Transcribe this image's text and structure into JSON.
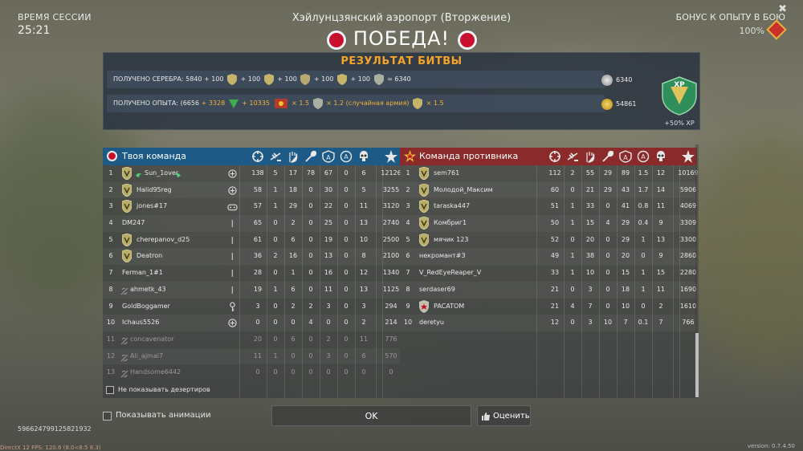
{
  "session": {
    "label": "ВРЕМЯ СЕССИИ",
    "time": "25:21"
  },
  "map_name": "Хэйлунцзянский аэропорт (Вторжение)",
  "result_title": "ПОБЕДА!",
  "xp_bonus": {
    "label": "БОНУС К ОПЫТУ В БОЮ",
    "value": "100%",
    "icon": "rank-badge-icon"
  },
  "battle_result": {
    "title": "РЕЗУЛЬТАТ БИТВЫ",
    "silver": {
      "label": "ПОЛУЧЕНО СЕРЕБРА:",
      "base": "5840",
      "plus1": "+ 100",
      "plus2": "+ 100",
      "plus3": "+ 100",
      "plus4": "+ 100",
      "plus5": "+ 100",
      "equals": "= 6340",
      "total": "6340",
      "icon": "silver-coin-icon"
    },
    "xp": {
      "label": "ПОЛУЧЕНО ОПЫТА: (6656",
      "plus1": "+ 3328",
      "plus2": "+ 10335",
      "mult1": "× 1.5",
      "mult2": "× 1.2 (случайная армия)",
      "mult3": "× 1.5",
      "total": "54861",
      "icon": "gold-coin-icon"
    },
    "xp_badge": "XP",
    "xp_percent": "+50% XP"
  },
  "my_team": {
    "title": "Твоя команда",
    "color": "#1e5a86",
    "columns": [
      "kills-target-icon",
      "planes-destroyed-icon",
      "assists-hand-icon",
      "repairs-wrench-icon",
      "captures-a-icon",
      "capture-defense-icon",
      "deaths-skull-icon",
      "score-star-icon"
    ],
    "players": [
      {
        "n": "1",
        "name": "Sun_1over",
        "rank": true,
        "squad": true,
        "status": "plus",
        "k": "138",
        "p": "5",
        "a": "17",
        "r": "78",
        "c": "67",
        "d": "0",
        "s": "6",
        "sc": "12126"
      },
      {
        "n": "2",
        "name": "Halid95reg",
        "rank": true,
        "status": "plus",
        "k": "58",
        "p": "1",
        "a": "18",
        "r": "0",
        "c": "30",
        "d": "0",
        "s": "5",
        "sc": "3255"
      },
      {
        "n": "3",
        "name": "jones#17",
        "rank": true,
        "status": "gamepad",
        "k": "57",
        "p": "1",
        "a": "29",
        "r": "0",
        "c": "22",
        "d": "0",
        "s": "11",
        "sc": "3120"
      },
      {
        "n": "4",
        "name": "DM247",
        "rank": false,
        "status": "bar",
        "k": "65",
        "p": "0",
        "a": "2",
        "r": "0",
        "c": "25",
        "d": "0",
        "s": "13",
        "sc": "2740"
      },
      {
        "n": "5",
        "name": "cherepanov_d25",
        "rank": true,
        "status": "bar",
        "k": "61",
        "p": "0",
        "a": "6",
        "r": "0",
        "c": "19",
        "d": "0",
        "s": "10",
        "sc": "2500"
      },
      {
        "n": "6",
        "name": "Deatron",
        "rank": true,
        "status": "bar",
        "k": "36",
        "p": "2",
        "a": "16",
        "r": "0",
        "c": "13",
        "d": "0",
        "s": "8",
        "sc": "2100"
      },
      {
        "n": "7",
        "name": "Ferman_1#1",
        "rank": false,
        "status": "bar",
        "k": "28",
        "p": "0",
        "a": "1",
        "r": "0",
        "c": "16",
        "d": "0",
        "s": "12",
        "sc": "1340"
      },
      {
        "n": "8",
        "name": "ahmetk_43",
        "rank": false,
        "muted": true,
        "status": "bar",
        "k": "19",
        "p": "1",
        "a": "6",
        "r": "0",
        "c": "11",
        "d": "0",
        "s": "13",
        "sc": "1125"
      },
      {
        "n": "9",
        "name": "GoldBoggamer",
        "rank": false,
        "status": "key",
        "k": "3",
        "p": "0",
        "a": "2",
        "r": "2",
        "c": "3",
        "d": "0",
        "s": "3",
        "sc": "294"
      },
      {
        "n": "10",
        "name": "Ichaus5526",
        "rank": false,
        "status": "plus",
        "k": "0",
        "p": "0",
        "a": "0",
        "r": "4",
        "c": "0",
        "d": "0",
        "s": "2",
        "sc": "214"
      },
      {
        "n": "11",
        "name": "concavenator",
        "rank": false,
        "deserter": true,
        "k": "20",
        "p": "0",
        "a": "6",
        "r": "0",
        "c": "2",
        "d": "0",
        "s": "11",
        "sc": "776"
      },
      {
        "n": "12",
        "name": "Ali_ajmai7",
        "rank": false,
        "deserter": true,
        "k": "11",
        "p": "1",
        "a": "0",
        "r": "0",
        "c": "3",
        "d": "0",
        "s": "6",
        "sc": "570"
      },
      {
        "n": "13",
        "name": "Handsome6442",
        "rank": false,
        "deserter": true,
        "k": "0",
        "p": "0",
        "a": "0",
        "r": "0",
        "c": "0",
        "d": "0",
        "s": "0",
        "sc": "0"
      }
    ]
  },
  "enemy_team": {
    "title": "Команда противника",
    "color": "#8a2a2a",
    "players": [
      {
        "n": "1",
        "name": "sem761",
        "rank": true,
        "k": "112",
        "p": "2",
        "a": "55",
        "r": "29",
        "c": "89",
        "d": "1.5",
        "s": "12",
        "sc": "10169"
      },
      {
        "n": "2",
        "name": "Молодой_Максим",
        "rank": true,
        "k": "60",
        "p": "0",
        "a": "21",
        "r": "29",
        "c": "43",
        "d": "1.7",
        "s": "14",
        "sc": "5906"
      },
      {
        "n": "3",
        "name": "taraska447",
        "rank": true,
        "k": "51",
        "p": "1",
        "a": "33",
        "r": "0",
        "c": "41",
        "d": "0.8",
        "s": "11",
        "sc": "4069"
      },
      {
        "n": "4",
        "name": "Комбриг1",
        "rank": true,
        "k": "50",
        "p": "1",
        "a": "15",
        "r": "4",
        "c": "29",
        "d": "0.4",
        "s": "9",
        "sc": "3309"
      },
      {
        "n": "5",
        "name": "мячик 123",
        "rank": true,
        "k": "52",
        "p": "0",
        "a": "20",
        "r": "0",
        "c": "29",
        "d": "1",
        "s": "13",
        "sc": "3300"
      },
      {
        "n": "6",
        "name": "некромант#3",
        "rank": false,
        "k": "49",
        "p": "1",
        "a": "38",
        "r": "0",
        "c": "20",
        "d": "0",
        "s": "9",
        "sc": "2860"
      },
      {
        "n": "7",
        "name": "V_RedEyeReaper_V",
        "rank": false,
        "k": "33",
        "p": "1",
        "a": "10",
        "r": "0",
        "c": "15",
        "d": "1",
        "s": "15",
        "sc": "2280"
      },
      {
        "n": "8",
        "name": "serdaser69",
        "rank": false,
        "k": "21",
        "p": "0",
        "a": "3",
        "r": "0",
        "c": "18",
        "d": "1",
        "s": "11",
        "sc": "1690"
      },
      {
        "n": "9",
        "name": "PACATOM",
        "rank": true,
        "star": true,
        "k": "21",
        "p": "4",
        "a": "7",
        "r": "0",
        "c": "10",
        "d": "0",
        "s": "2",
        "sc": "1610"
      },
      {
        "n": "10",
        "name": "deretyu",
        "rank": false,
        "k": "12",
        "p": "0",
        "a": "3",
        "r": "10",
        "c": "7",
        "d": "0.1",
        "s": "7",
        "sc": "766"
      }
    ]
  },
  "hide_deserters_label": "Не показывать дезертиров",
  "show_animations_label": "Показывать анимации",
  "ok_label": "OK",
  "rate_label": "Оценить",
  "footer_id": "596624799125821932",
  "fps_text": "DirectX 12 FPS: 120.6 (8.0<8.5 8.3)",
  "version": "version: 0.7.4.50"
}
